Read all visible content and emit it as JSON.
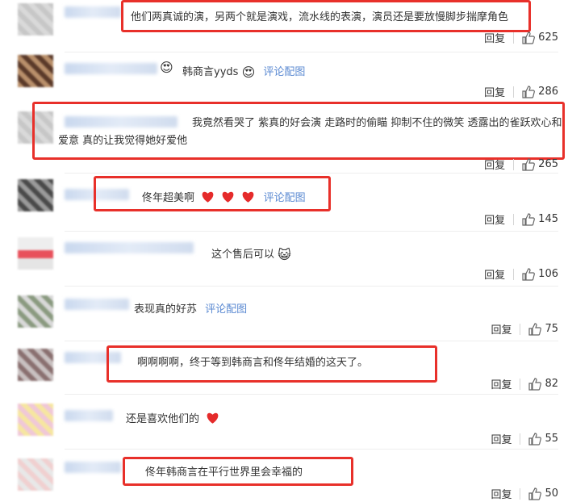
{
  "comments": [
    {
      "text": "他们两真诚的演，另两个就是演戏，流水线的表演，演员还是要放慢脚步揣摩角色",
      "link": "",
      "reply": "回复",
      "likes": "625"
    },
    {
      "text": "韩商言yyds",
      "link": "评论配图",
      "reply": "回复",
      "likes": "286"
    },
    {
      "text": "我竟然看哭了 紫真的好会演 走路时的偷瞄 抑制不住的微笑 透露出的雀跃欢心和爱意 真的让我觉得她好爱他",
      "link": "",
      "reply": "回复",
      "likes": "265"
    },
    {
      "text": "佟年超美啊",
      "link": "评论配图",
      "reply": "回复",
      "likes": "145"
    },
    {
      "text": "这个售后可以",
      "link": "",
      "reply": "回复",
      "likes": "106"
    },
    {
      "text": "表现真的好苏",
      "link": "评论配图",
      "reply": "回复",
      "likes": "75"
    },
    {
      "text": "啊啊啊啊，终于等到韩商言和佟年结婚的这天了。",
      "link": "",
      "reply": "回复",
      "likes": "82"
    },
    {
      "text": "还是喜欢他们的",
      "link": "",
      "reply": "回复",
      "likes": "55"
    },
    {
      "text": "佟年韩商言在平行世界里会幸福的",
      "link": "",
      "reply": "回复",
      "likes": "50"
    }
  ],
  "colors": {
    "highlight": "#e8302a",
    "link": "#5b8ad2"
  },
  "icons": [
    "thumbs-up-icon",
    "heart-icon",
    "cat-emoji-icon",
    "heart-eyes-emoji-icon"
  ]
}
